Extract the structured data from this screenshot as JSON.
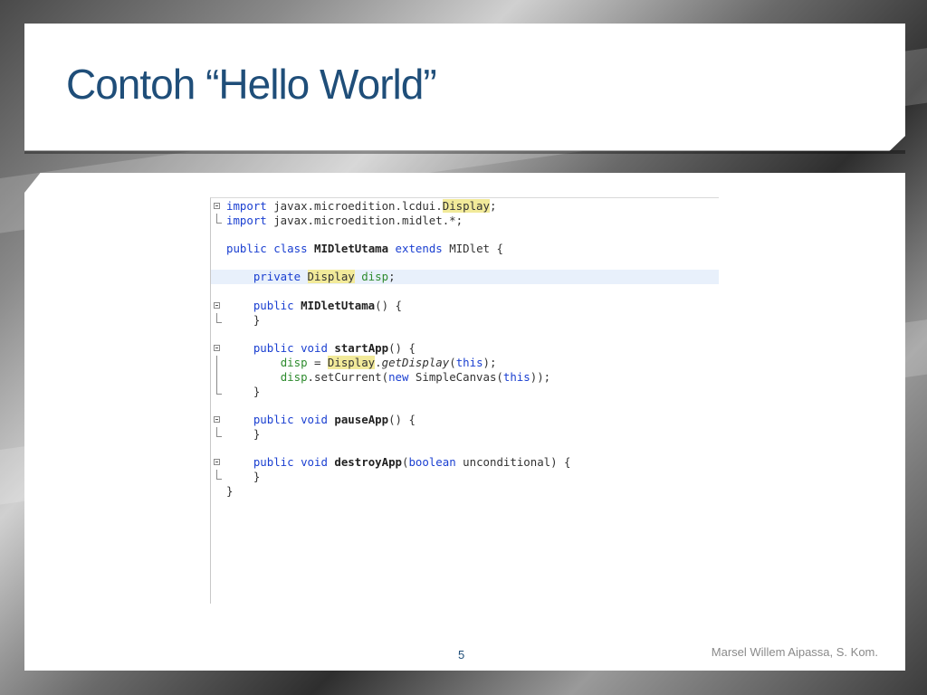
{
  "slide": {
    "title": "Contoh “Hello World”",
    "page_number": "5",
    "author": "Marsel Willem Aipassa, S. Kom."
  },
  "code": {
    "t": {
      "import": "import",
      "public": "public",
      "class": "class",
      "extends": "extends",
      "private": "private",
      "void": "void",
      "this": "this",
      "new": "new",
      "boolean": "boolean",
      "pkg_lcdui": " javax.microedition.lcdui.",
      "pkg_midlet": " javax.microedition.midlet.*;",
      "semicolon": ";",
      "class_name": "MIDletUtama",
      "midlet": " MIDlet {",
      "display": "Display",
      "disp": "disp",
      "ctor_paren": "() {",
      "close_brace": "}",
      "start_app": "startApp",
      "assign": " = ",
      "dot": ".",
      "get_display": "getDisplay",
      "open_paren": "(",
      "close_call": ");",
      "set_current": ".setCurrent(",
      "simple_canvas": " SimpleCanvas(",
      "close_double": "));",
      "pause_app": "pauseApp",
      "destroy_app": "destroyApp",
      "unconditional": " unconditional) {"
    }
  }
}
